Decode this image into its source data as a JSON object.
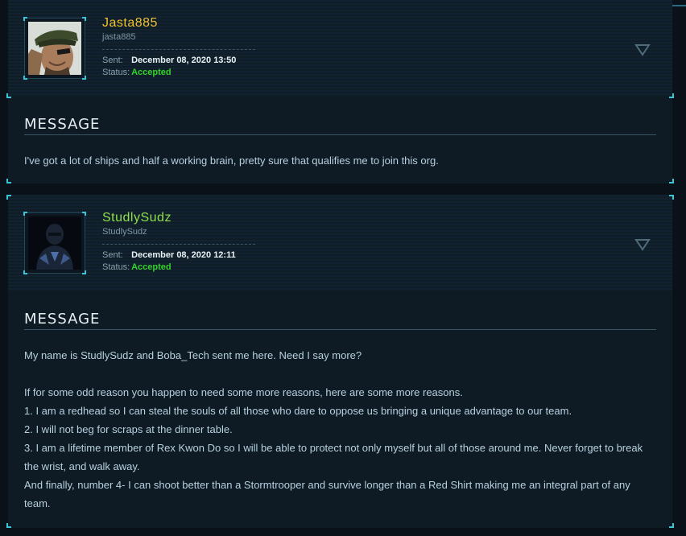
{
  "colors": {
    "accent": "#39c6d6",
    "gold_handle": "#f2c12e",
    "green_handle": "#8fe04a",
    "accepted": "#33d22a"
  },
  "applications": [
    {
      "handle": "Jasta885",
      "nickname": "jasta885",
      "sent_label": "Sent:",
      "sent_value": "December 08, 2020 13:50",
      "status_label": "Status:",
      "status_value": "Accepted",
      "message_heading": "MESSAGE",
      "message_lines": [
        "I've got a lot of ships and half a working brain, pretty sure that qualifies me to join this org."
      ],
      "toggle_icon": "chevron-down-icon"
    },
    {
      "handle": "StudlySudz",
      "nickname": "StudlySudz",
      "sent_label": "Sent:",
      "sent_value": "December 08, 2020 12:11",
      "status_label": "Status:",
      "status_value": "Accepted",
      "message_heading": "MESSAGE",
      "message_lines": [
        "My name is StudlySudz and Boba_Tech sent me here. Need I say more?",
        "",
        "If for some odd reason you happen to need some more reasons, here are some more reasons.",
        "1. I am a redhead so I can steal the souls of all those who dare to oppose us bringing a unique advantage to our team.",
        "2. I will not beg for scraps at the dinner table.",
        "3. I am a lifetime member of Rex Kwon Do so I will be able to protect not only myself but all of those around me. Never forget to break the wrist, and walk away.",
        "And finally, number 4- I can shoot better than a Stormtrooper and survive longer than a Red Shirt making me an integral part of any team."
      ],
      "toggle_icon": "chevron-down-icon"
    }
  ]
}
